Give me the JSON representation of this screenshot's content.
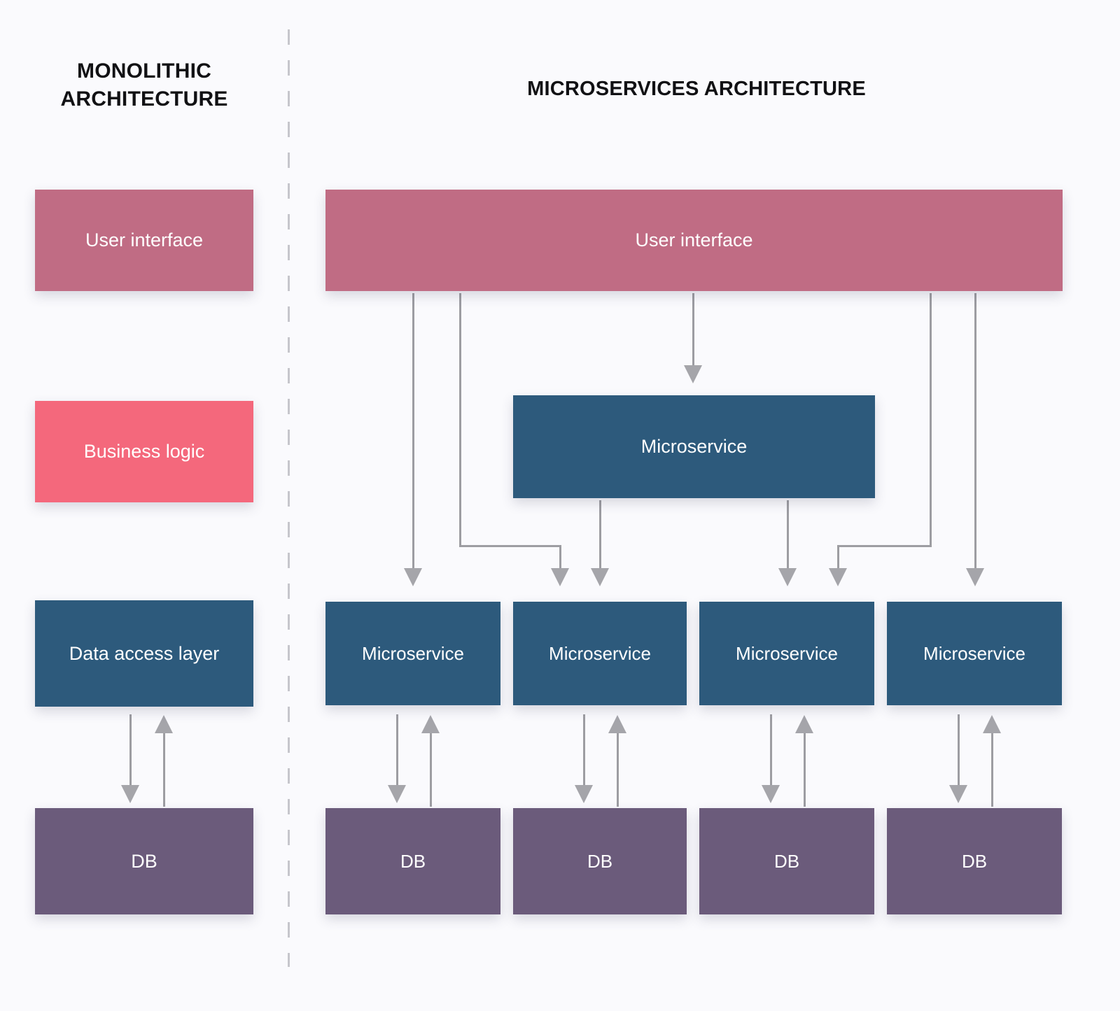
{
  "diagram": {
    "background_color": "#fafafd",
    "panels": {
      "monolithic": {
        "title": "MONOLITHIC\nARCHITECTURE",
        "boxes": [
          {
            "label": "User interface",
            "color": "#c06c84"
          },
          {
            "label": "Business logic",
            "color": "#f4687c"
          },
          {
            "label": "Data access layer",
            "color": "#2d5a7c"
          },
          {
            "label": "DB",
            "color": "#6b5b7b"
          }
        ]
      },
      "microservices": {
        "title": "MICROSERVICES ARCHITECTURE",
        "ui_box": {
          "label": "User interface",
          "color": "#c06c84"
        },
        "top_service": {
          "label": "Microservice",
          "color": "#2d5a7c"
        },
        "services": [
          {
            "label": "Microservice",
            "color": "#2d5a7c"
          },
          {
            "label": "Microservice",
            "color": "#2d5a7c"
          },
          {
            "label": "Microservice",
            "color": "#2d5a7c"
          },
          {
            "label": "Microservice",
            "color": "#2d5a7c"
          }
        ],
        "databases": [
          {
            "label": "DB",
            "color": "#6b5b7b"
          },
          {
            "label": "DB",
            "color": "#6b5b7b"
          },
          {
            "label": "DB",
            "color": "#6b5b7b"
          },
          {
            "label": "DB",
            "color": "#6b5b7b"
          }
        ]
      }
    },
    "connector_color": "#9d9da2",
    "divider_color": "#c6c6cc"
  }
}
